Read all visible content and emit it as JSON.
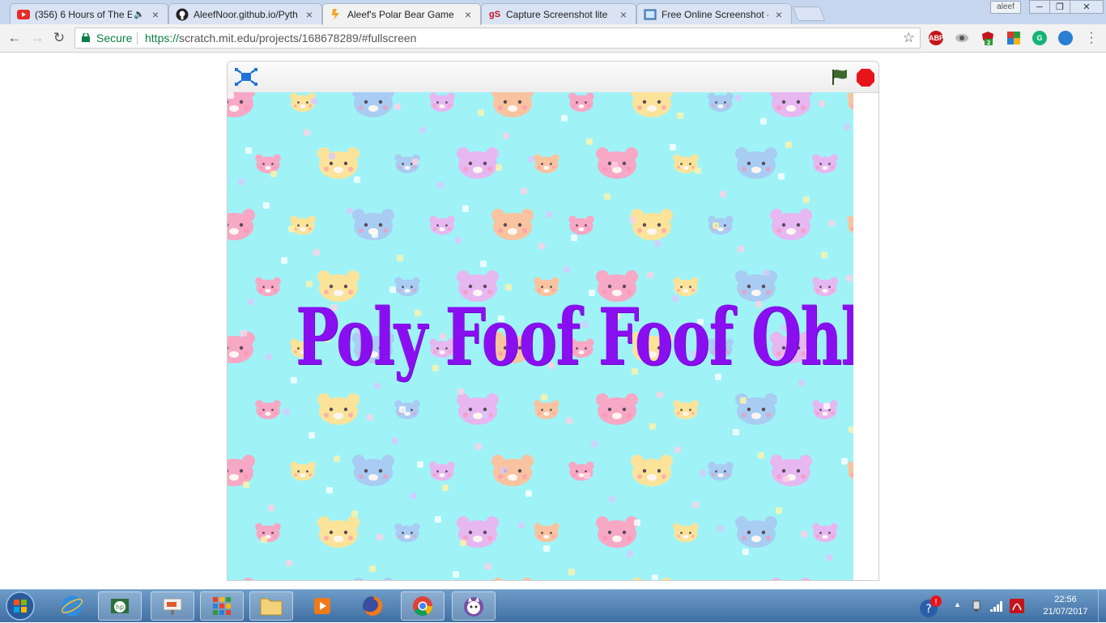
{
  "browser": {
    "tabs": [
      {
        "title": "(356) 6 Hours of The E",
        "favicon": "youtube-icon",
        "active": false
      },
      {
        "title": "AleefNoor.github.io/Pyth",
        "favicon": "github-icon",
        "active": false
      },
      {
        "title": "Aleef's Polar Bear Game",
        "favicon": "scratch-icon",
        "active": true
      },
      {
        "title": "Capture Screenshot lite",
        "favicon": "gs-icon",
        "active": false
      },
      {
        "title": "Free Online Screenshot -",
        "favicon": "screenshot-icon",
        "active": false
      }
    ],
    "favicon_text_gs": "gS",
    "close_glyph": "×",
    "profile_name": "aleef",
    "secure_label": "Secure",
    "url_protocol": "https://",
    "url_rest": "scratch.mit.edu/projects/168678289/#fullscreen",
    "extensions": [
      {
        "name": "adblock-plus-icon",
        "label": "ABP",
        "color": "#c4151c"
      },
      {
        "name": "eye-extension-icon",
        "label": "",
        "color": "#888888"
      },
      {
        "name": "ublock-icon",
        "label": "",
        "color": "#c4151c"
      },
      {
        "name": "puzzle-extension-icon",
        "label": "",
        "color": "#2f9a3a"
      },
      {
        "name": "grammarly-icon",
        "label": "G",
        "color": "#14b476"
      },
      {
        "name": "globe-extension-icon",
        "label": "",
        "color": "#2a7fd4"
      }
    ],
    "ublock_badge": "2"
  },
  "stage": {
    "title_text": "Poly Foof Foof Ohh",
    "background_color": "#9ff3f7",
    "title_color": "#8a0ff0"
  },
  "taskbar": {
    "time": "22:56",
    "date": "21/07/2017",
    "apps": [
      "internet-explorer-icon",
      "hp-icon",
      "presentation-icon",
      "tiles-icon",
      "file-explorer-icon",
      "media-player-icon",
      "firefox-icon",
      "chrome-icon",
      "scratch-cat-icon"
    ]
  }
}
